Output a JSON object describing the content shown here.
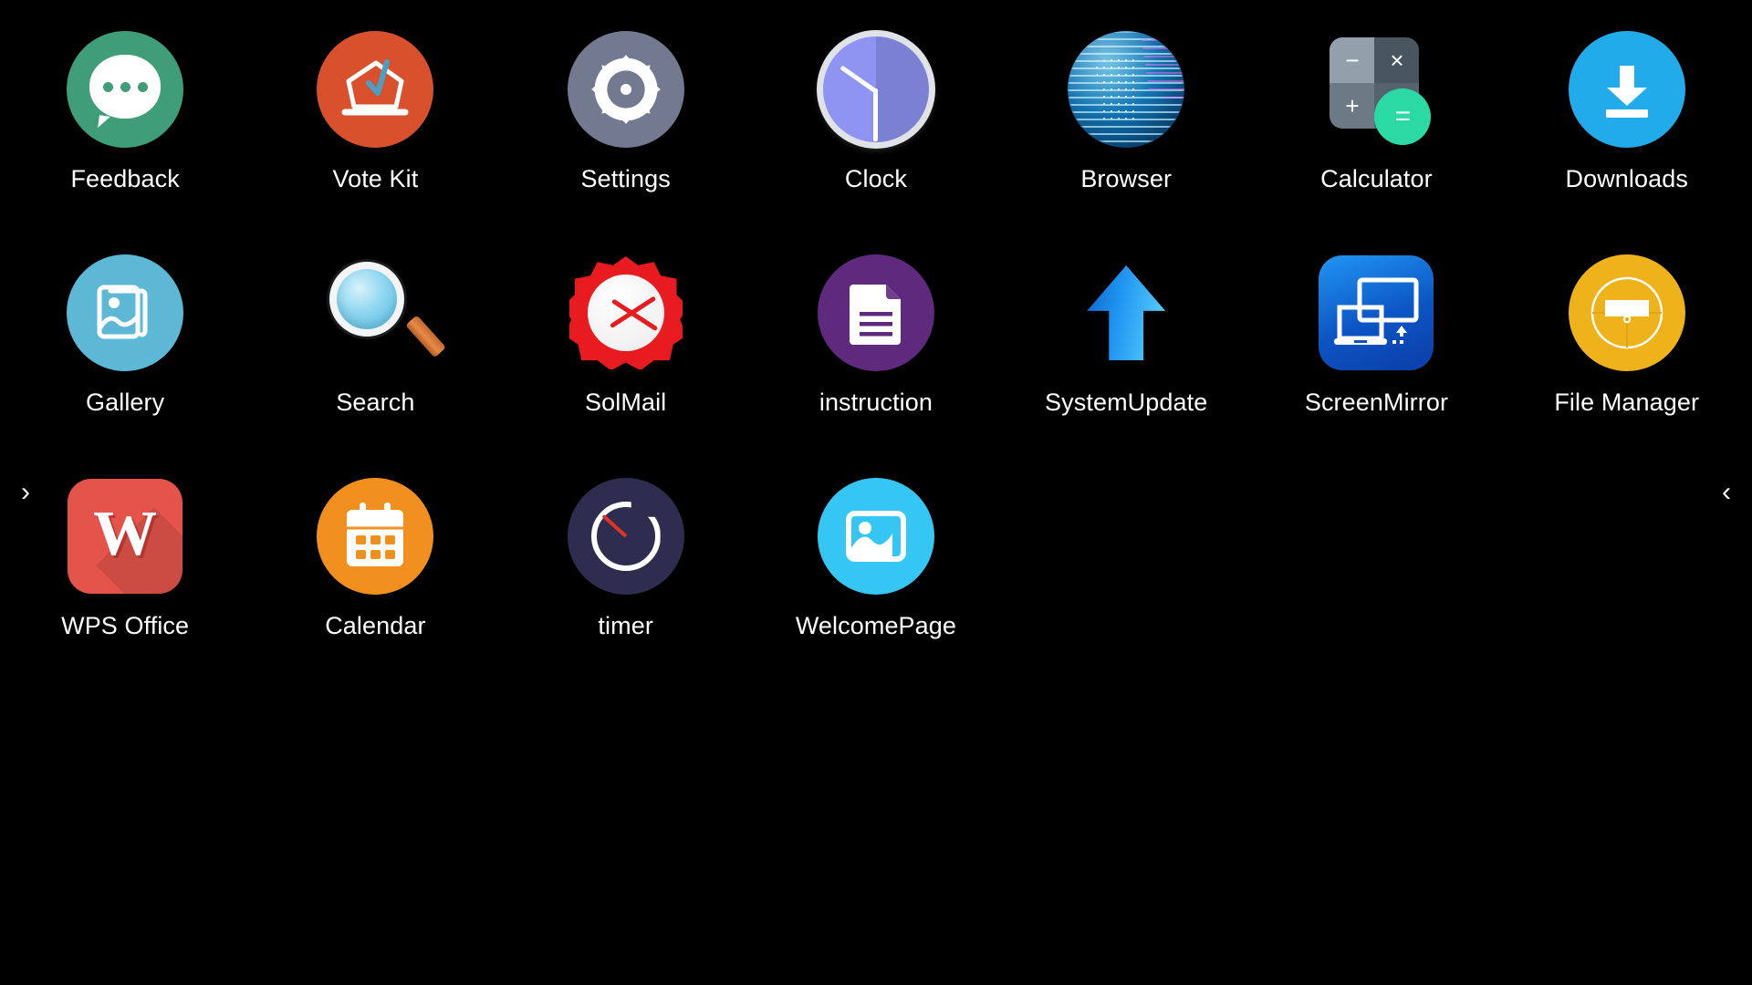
{
  "screen": {
    "name": "android-app-launcher",
    "background_color": "#000000",
    "label_color": "#ffffff"
  },
  "navigation": {
    "left_arrow": "›",
    "right_arrow": "‹",
    "left_arrow_icon": "chevron-right-icon",
    "right_arrow_icon": "chevron-left-icon"
  },
  "apps": [
    {
      "label": "Feedback",
      "icon": "speech-bubble-icon",
      "color": "#3f9e78"
    },
    {
      "label": "Vote Kit",
      "icon": "ballot-box-icon",
      "color": "#d9512c"
    },
    {
      "label": "Settings",
      "icon": "gear-icon",
      "color": "#737a90"
    },
    {
      "label": "Clock",
      "icon": "analog-clock-icon",
      "color": "#8f93f2"
    },
    {
      "label": "Browser",
      "icon": "globe-icon",
      "color": "#1470ad"
    },
    {
      "label": "Calculator",
      "icon": "calculator-icon",
      "color": "#49565f"
    },
    {
      "label": "Downloads",
      "icon": "download-arrow-icon",
      "color": "#22abea"
    },
    {
      "label": "Gallery",
      "icon": "photos-stack-icon",
      "color": "#5cb8d4"
    },
    {
      "label": "Search",
      "icon": "magnifier-icon",
      "color": "#8ed6f0"
    },
    {
      "label": "SolMail",
      "icon": "envelope-burst-icon",
      "color": "#e81c20"
    },
    {
      "label": "instruction",
      "icon": "document-page-icon",
      "color": "#5f2a7e"
    },
    {
      "label": "SystemUpdate",
      "icon": "up-arrow-icon",
      "color": "#2196f3"
    },
    {
      "label": "ScreenMirror",
      "icon": "screen-cast-icon",
      "color": "#0c55c4"
    },
    {
      "label": "File Manager",
      "icon": "file-cabinet-icon",
      "color": "#eeb21a"
    },
    {
      "label": "WPS Office",
      "icon": "wps-w-icon",
      "color": "#e4544a"
    },
    {
      "label": "Calendar",
      "icon": "calendar-icon",
      "color": "#f2901f"
    },
    {
      "label": "timer",
      "icon": "timer-dial-icon",
      "color": "#2e2d50"
    },
    {
      "label": "WelcomePage",
      "icon": "picture-icon",
      "color": "#35c6f4"
    }
  ],
  "calculator_symbols": {
    "minus": "−",
    "multiply": "×",
    "plus": "+",
    "equals": "="
  },
  "wps_logo_letter": "W"
}
